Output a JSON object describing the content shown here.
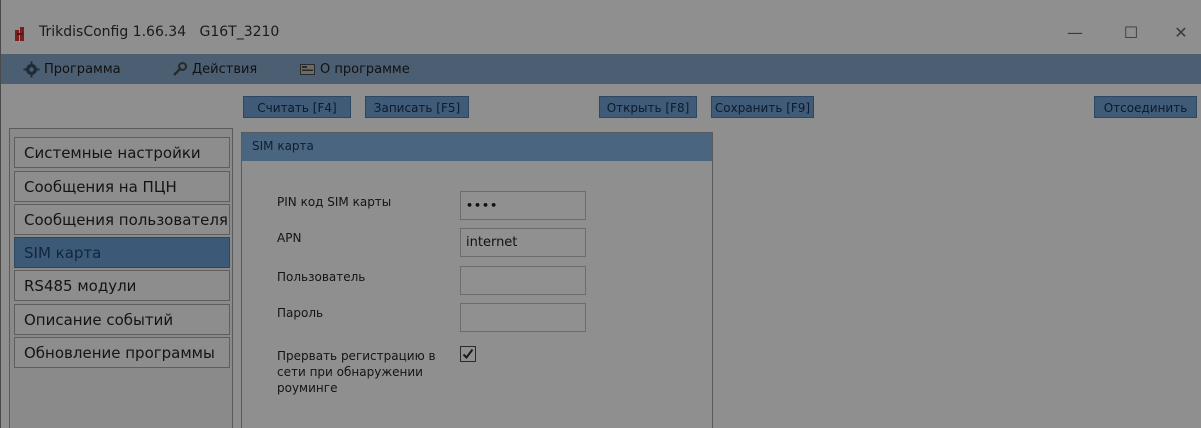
{
  "window": {
    "title": "TrikdisConfig 1.66.34   G16T_3210",
    "minimize_symbol": "—",
    "maximize_symbol": "☐",
    "close_symbol": "✕"
  },
  "menu": {
    "items": [
      {
        "label": "Программа",
        "icon": "gear-icon"
      },
      {
        "label": "Действия",
        "icon": "wrench-icon"
      },
      {
        "label": "О программе",
        "icon": "info-icon"
      }
    ]
  },
  "toolbar": {
    "read_label": "Считать [F4]",
    "write_label": "Записать [F5]",
    "open_label": "Открыть [F8]",
    "save_label": "Сохранить [F9]",
    "disconnect_label": "Отсоединить"
  },
  "sidebar": {
    "items": [
      {
        "label": "Системные настройки"
      },
      {
        "label": "Сообщения на ПЦН"
      },
      {
        "label": "Сообщения пользователя"
      },
      {
        "label": "SIM карта",
        "selected": true
      },
      {
        "label": "RS485 модули"
      },
      {
        "label": "Описание событий"
      },
      {
        "label": "Обновление программы"
      }
    ]
  },
  "sim_panel": {
    "header": "SIM карта",
    "pin_label": "PIN код SIM карты",
    "pin_value": "••••",
    "apn_label": "APN",
    "apn_value": "internet",
    "user_label": "Пользователь",
    "user_value": "",
    "password_label": "Пароль",
    "password_value": "",
    "roaming_label_line1": "Прервать регистрацию в",
    "roaming_label_line2": "сети при обнаружении",
    "roaming_label_line3": "роуминге",
    "roaming_checked": true,
    "check_symbol": "✓"
  },
  "colors": {
    "accent": "#3f5b78",
    "menubar": "#4c5f72",
    "overlay_background": "#8f8f8f"
  }
}
